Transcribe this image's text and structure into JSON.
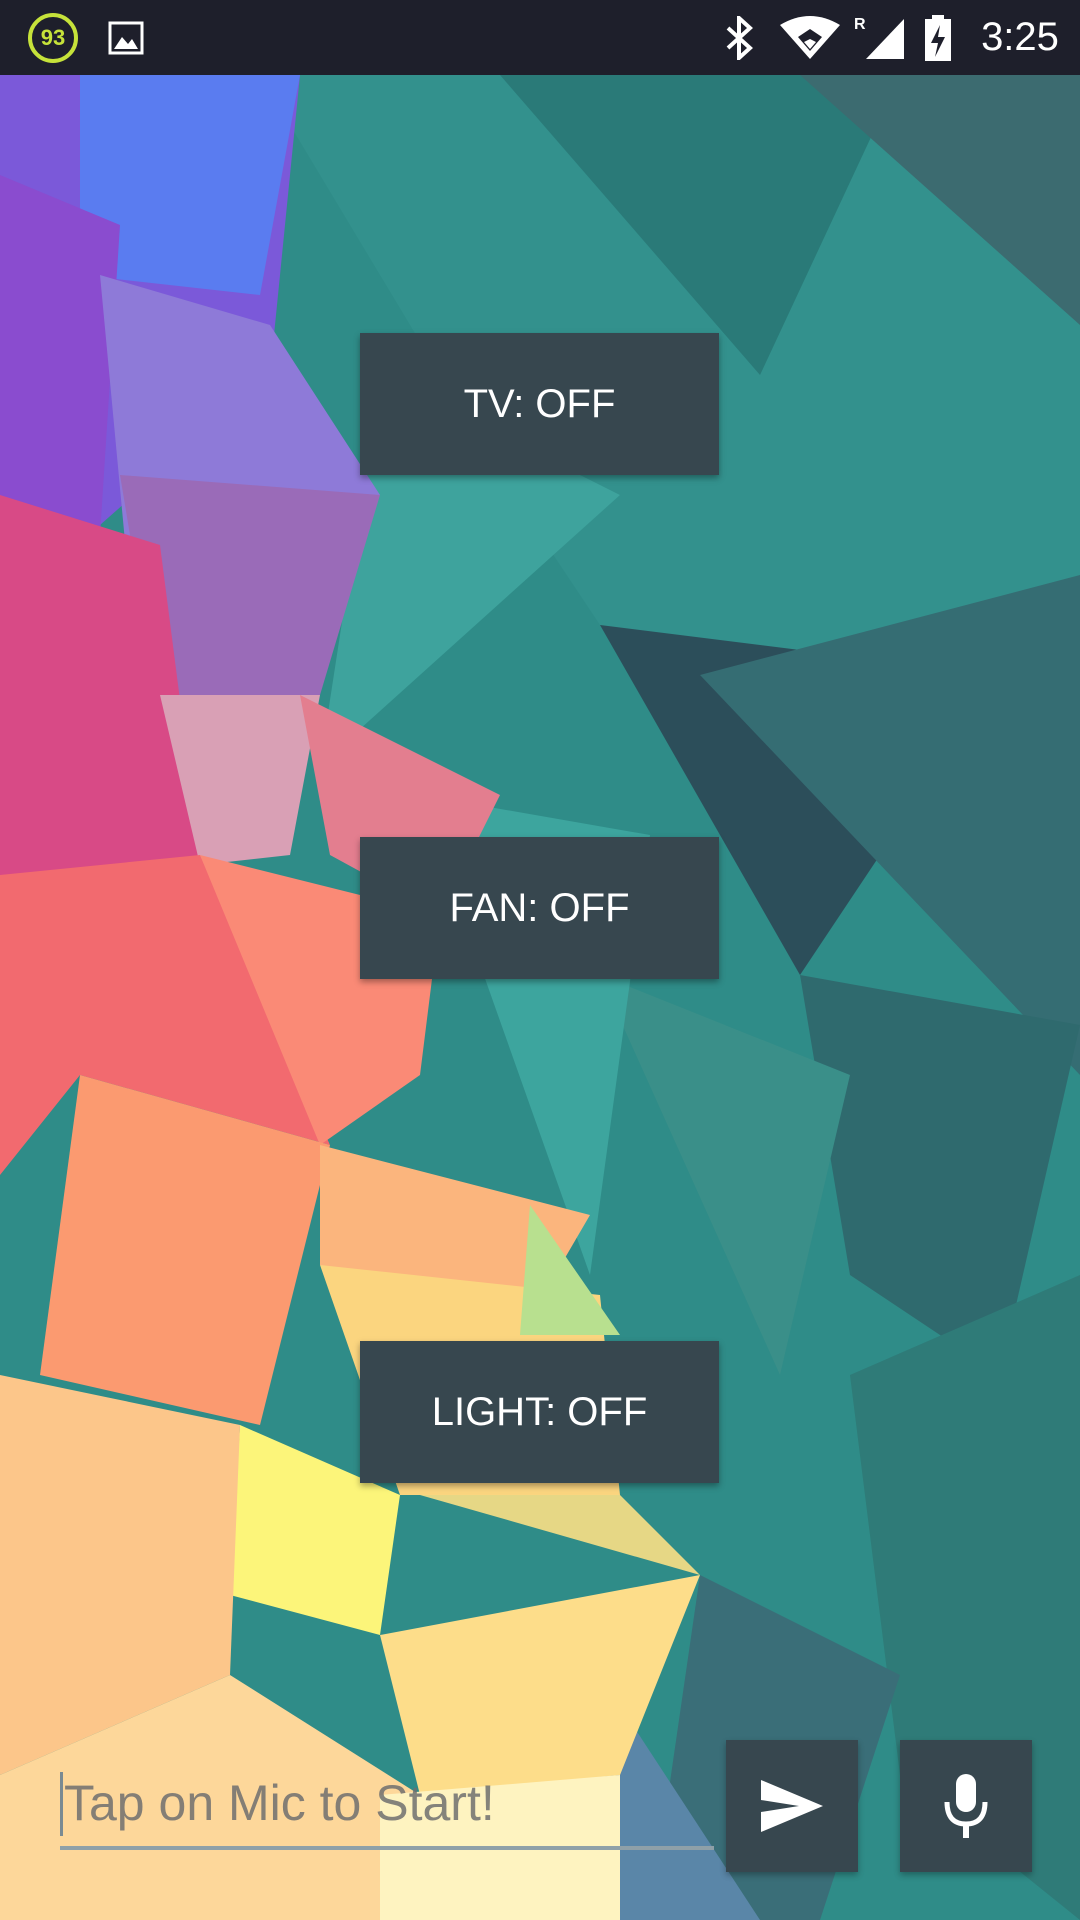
{
  "status_bar": {
    "battery_level": "93",
    "time": "3:25",
    "network_roaming_indicator": "R",
    "icons": [
      "battery-circle-icon",
      "gallery-icon",
      "bluetooth-icon",
      "wifi-icon",
      "signal-icon",
      "battery-charging-icon"
    ]
  },
  "controls": {
    "tv_label": "TV: OFF",
    "fan_label": "FAN: OFF",
    "light_label": "LIGHT: OFF"
  },
  "input": {
    "placeholder": "Tap on Mic to Start!",
    "value": ""
  },
  "actions": {
    "send_icon": "send-icon",
    "mic_icon": "mic-icon"
  },
  "colors": {
    "button_bg": "#37474f",
    "status_bar_bg": "#1e1f2b",
    "battery_accent": "#c6e23a"
  }
}
